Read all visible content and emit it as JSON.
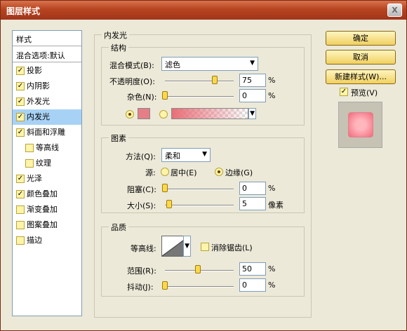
{
  "window": {
    "title": "图层样式",
    "close_label": "X"
  },
  "left_list": {
    "header": "样式",
    "blend_default": "混合选项:默认",
    "items": [
      {
        "label": "投影",
        "checked": true
      },
      {
        "label": "内阴影",
        "checked": true
      },
      {
        "label": "外发光",
        "checked": true
      },
      {
        "label": "内发光",
        "checked": true,
        "selected": true
      },
      {
        "label": "斜面和浮雕",
        "checked": true
      },
      {
        "label": "等高线",
        "checked": false,
        "sub": true
      },
      {
        "label": "纹理",
        "checked": false,
        "sub": true
      },
      {
        "label": "光泽",
        "checked": true
      },
      {
        "label": "颜色叠加",
        "checked": true
      },
      {
        "label": "渐变叠加",
        "checked": false
      },
      {
        "label": "图案叠加",
        "checked": false
      },
      {
        "label": "描边",
        "checked": false
      }
    ]
  },
  "panel": {
    "title": "内发光",
    "structure": {
      "title": "结构",
      "blend_mode_label": "混合模式(B):",
      "blend_mode_value": "滤色",
      "opacity_label": "不透明度(O):",
      "opacity_value": "75",
      "opacity_percent": 0.75,
      "noise_label": "杂色(N):",
      "noise_value": "0",
      "noise_percent": 0.0,
      "unit_percent": "%"
    },
    "elements": {
      "title": "图素",
      "method_label": "方法(Q):",
      "method_value": "柔和",
      "source_label": "源:",
      "source_center": "居中(E)",
      "source_edge": "边缘(G)",
      "choke_label": "阻塞(C):",
      "choke_value": "0",
      "size_label": "大小(S):",
      "size_value": "5",
      "size_unit": "像素",
      "unit_percent": "%"
    },
    "quality": {
      "title": "品质",
      "contour_label": "等高线:",
      "antialias_label": "消除锯齿(L)",
      "range_label": "范围(R):",
      "range_value": "50",
      "range_percent": 0.5,
      "jitter_label": "抖动(J):",
      "jitter_value": "0",
      "jitter_percent": 0.0,
      "unit_percent": "%"
    }
  },
  "buttons": {
    "ok": "确定",
    "cancel": "取消",
    "new_style": "新建样式(W)...",
    "preview_label": "预览(V)"
  },
  "colors": {
    "glow_color": "#e67e86",
    "titlebar": "#b84420"
  }
}
